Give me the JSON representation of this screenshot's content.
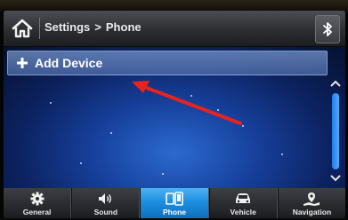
{
  "header": {
    "breadcrumb_parent": "Settings",
    "breadcrumb_separator": ">",
    "breadcrumb_current": "Phone",
    "home_icon": "home-icon",
    "bluetooth_icon": "bluetooth-icon"
  },
  "list": {
    "items": [
      {
        "label": "Add Device",
        "icon": "plus-icon"
      }
    ]
  },
  "scrollbar": {
    "position_fraction": 0.0,
    "visible_fraction": 1.0
  },
  "annotation": {
    "arrow_color": "#e8231e"
  },
  "nav": {
    "tabs": [
      {
        "label": "General",
        "icon": "gear-icon",
        "active": false
      },
      {
        "label": "Sound",
        "icon": "speaker-icon",
        "active": false
      },
      {
        "label": "Phone",
        "icon": "phone-icon",
        "active": true
      },
      {
        "label": "Vehicle",
        "icon": "car-icon",
        "active": false
      },
      {
        "label": "Navigation",
        "icon": "navigation-icon",
        "active": false
      }
    ]
  },
  "colors": {
    "active_tab": "#1d8fe0",
    "list_row": "#6e8fc8",
    "background": "#163f9a"
  }
}
